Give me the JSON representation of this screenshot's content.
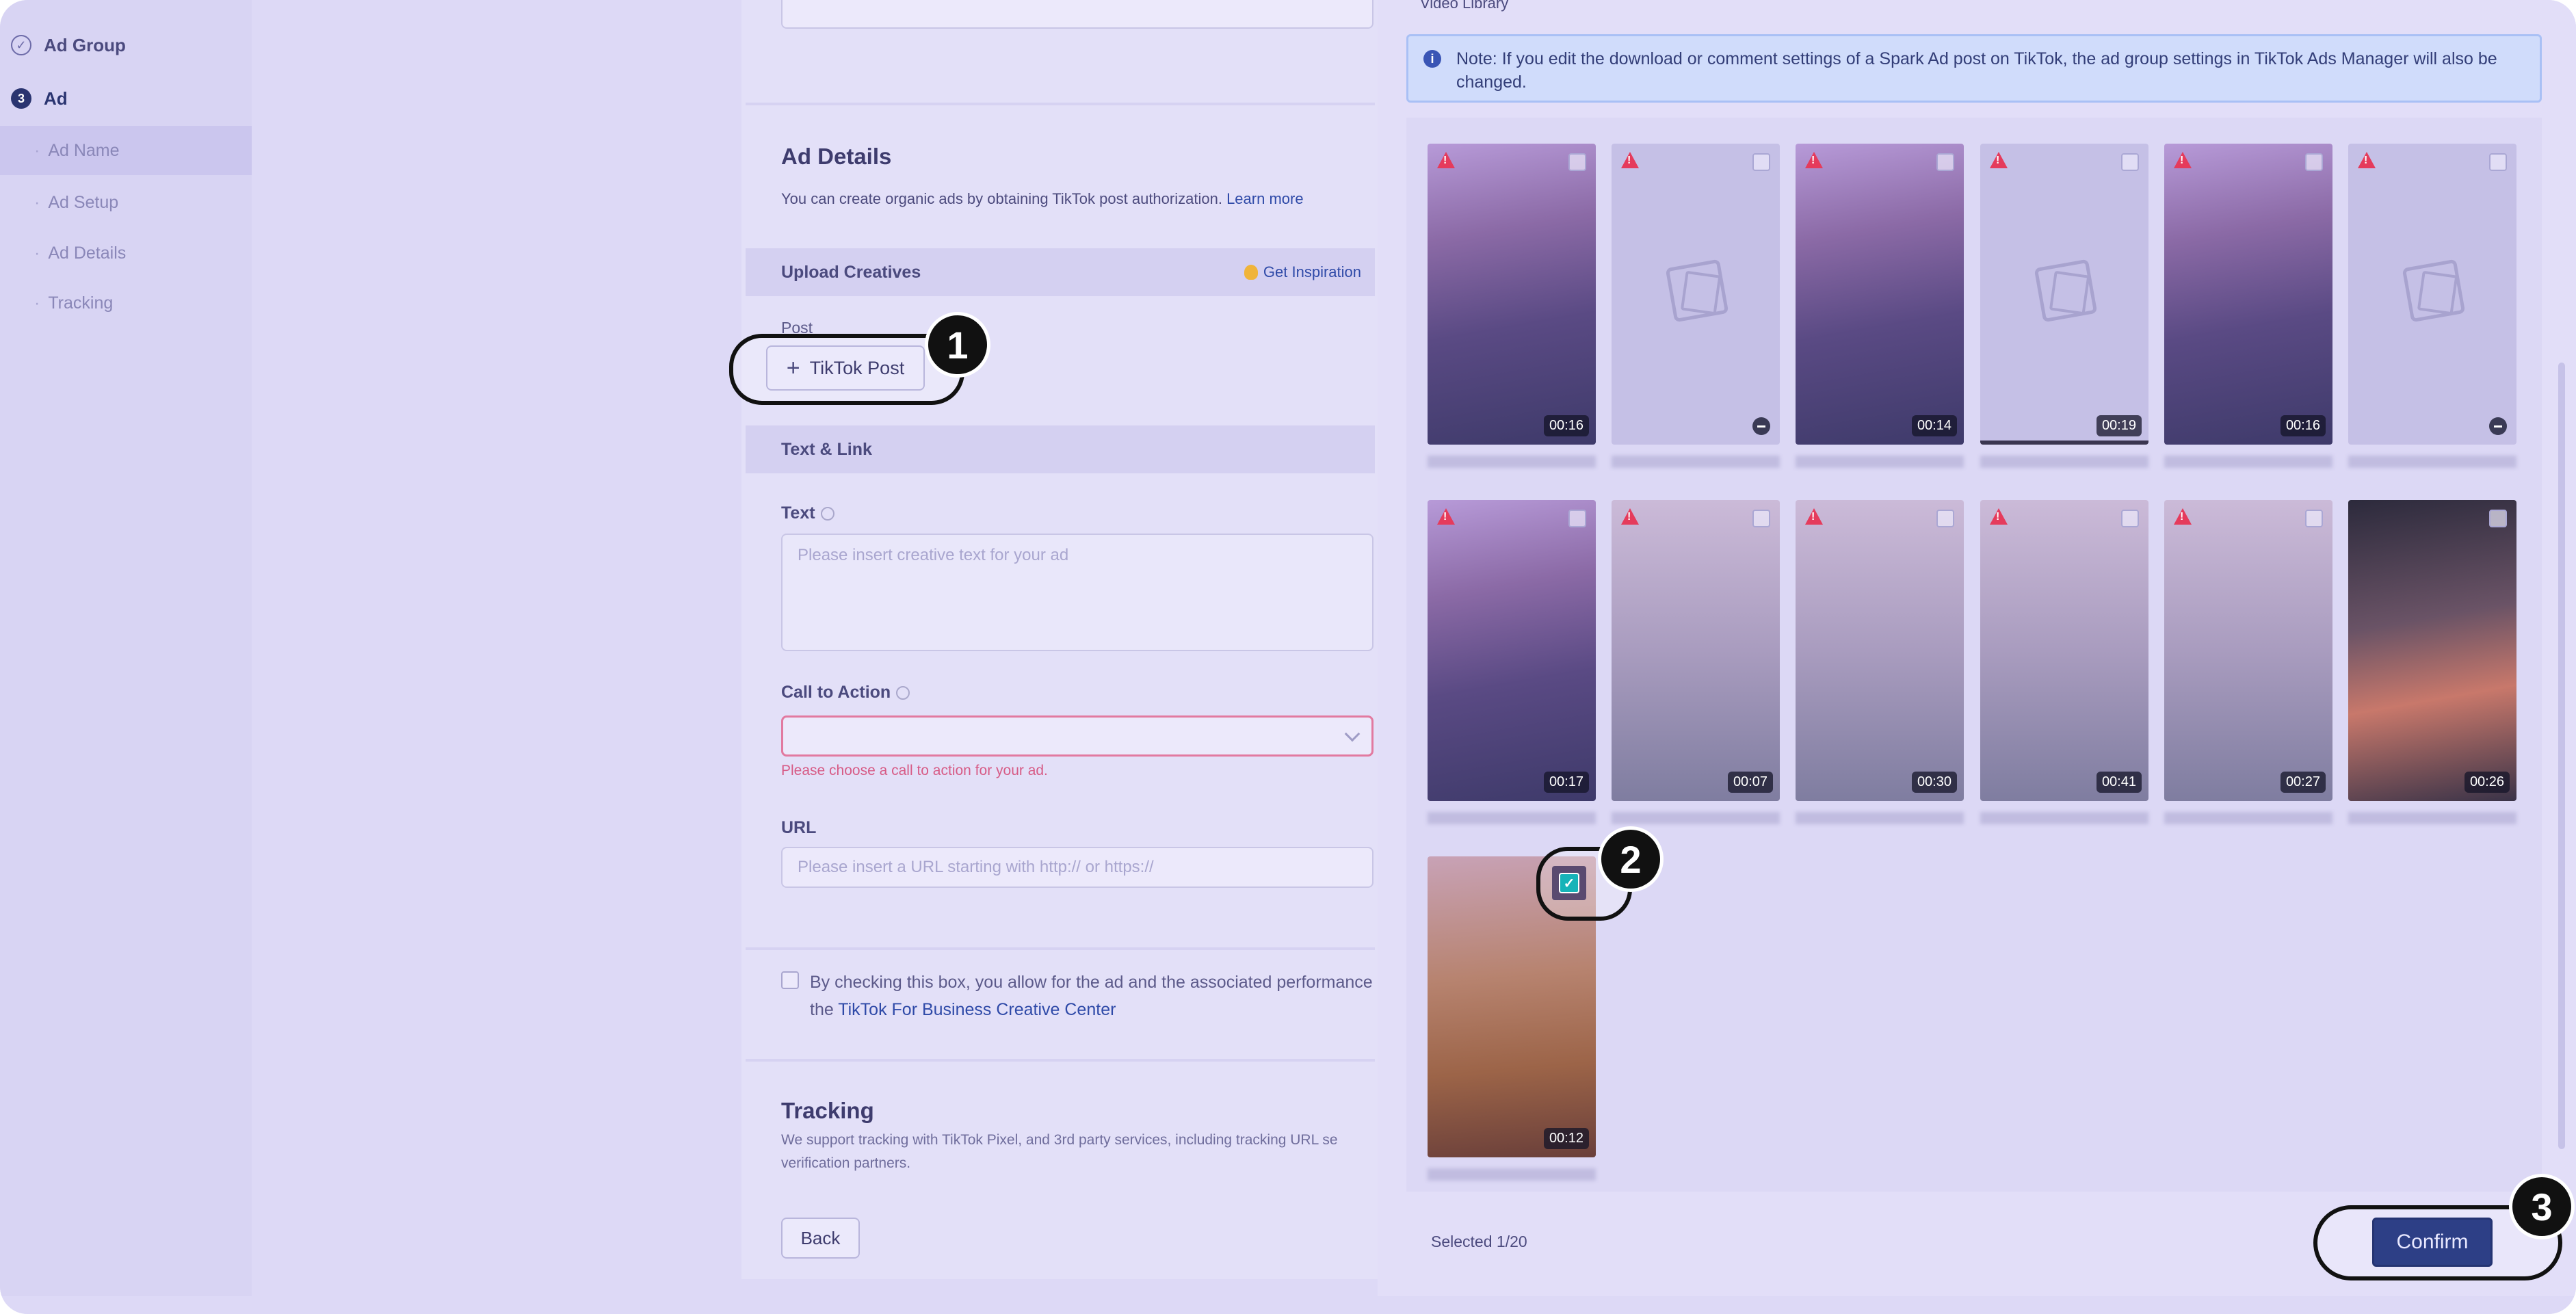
{
  "sidebar": {
    "steps": [
      {
        "label": "Ad Group",
        "state": "done"
      },
      {
        "number": "3",
        "label": "Ad",
        "state": "current"
      }
    ],
    "substeps": [
      "Ad Name",
      "Ad Setup",
      "Ad Details",
      "Tracking"
    ],
    "active_substep": "Ad Name"
  },
  "form": {
    "ad_details": {
      "title": "Ad Details",
      "description": "You can create organic ads by obtaining TikTok post authorization.",
      "learn_more": "Learn more"
    },
    "upload_creatives": {
      "title": "Upload Creatives",
      "get_inspiration": "Get Inspiration",
      "post_label": "Post",
      "tiktok_post_button": "TikTok Post"
    },
    "text_link": {
      "title": "Text & Link",
      "text_label": "Text",
      "text_placeholder": "Please insert creative text for your ad",
      "cta_label": "Call to Action",
      "cta_error": "Please choose a call to action for your ad.",
      "url_label": "URL",
      "url_placeholder": "Please insert a URL starting with http:// or https://"
    },
    "consent": {
      "line1": "By checking this box, you allow for the ad and the associated performance",
      "line2_prefix": "the",
      "line2_link": "TikTok For Business Creative Center"
    },
    "tracking": {
      "title": "Tracking",
      "line1": "We support tracking with TikTok Pixel, and 3rd party services, including tracking URL se",
      "line2": "verification partners."
    },
    "back_button": "Back"
  },
  "drawer": {
    "title": "Video Library",
    "note": "Note: If you edit the download or comment settings of a Spark Ad post on TikTok, the ad group settings in TikTok Ads Manager will also be changed.",
    "videos": [
      {
        "duration": "00:16",
        "kind": "photo",
        "warning": true
      },
      {
        "duration": "",
        "kind": "blank",
        "warning": true
      },
      {
        "duration": "00:14",
        "kind": "photo",
        "warning": true
      },
      {
        "duration": "00:19",
        "kind": "blank",
        "warning": true
      },
      {
        "duration": "00:16",
        "kind": "photo",
        "warning": true
      },
      {
        "duration": "",
        "kind": "blank",
        "warning": true
      },
      {
        "duration": "00:17",
        "kind": "photo",
        "warning": true
      },
      {
        "duration": "00:07",
        "kind": "plain",
        "warning": true
      },
      {
        "duration": "00:30",
        "kind": "plain",
        "warning": true
      },
      {
        "duration": "00:41",
        "kind": "plain",
        "warning": true
      },
      {
        "duration": "00:27",
        "kind": "plain",
        "warning": true
      },
      {
        "duration": "00:26",
        "kind": "color",
        "warning": false
      },
      {
        "duration": "00:12",
        "kind": "selected",
        "warning": false,
        "selected": true
      }
    ],
    "selected_count": "Selected 1/20",
    "confirm_button": "Confirm"
  },
  "callouts": [
    "1",
    "2",
    "3"
  ],
  "colors": {
    "overlay": "#ddd9f6",
    "confirm": "#2d3f86",
    "error": "#d75b86",
    "link": "#2f4aa8",
    "selected_check": "#17b3b8"
  }
}
